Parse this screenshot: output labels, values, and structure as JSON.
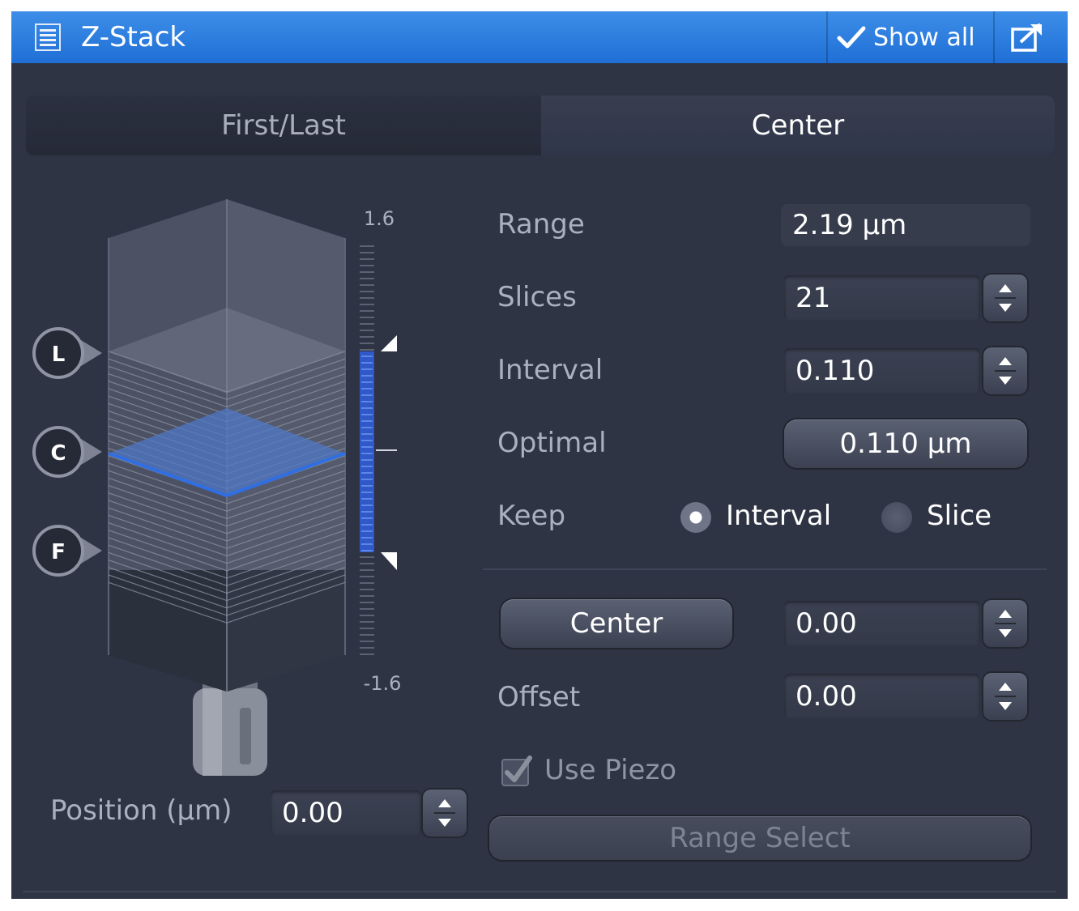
{
  "title_bar": {
    "title": "Z-Stack",
    "show_all": "Show all",
    "accent": "#2a7fe0"
  },
  "tabs": [
    {
      "label": "First/Last",
      "selected": false
    },
    {
      "label": "Center",
      "selected": true
    }
  ],
  "visual": {
    "scale_top": "1.6",
    "scale_bottom": "-1.6",
    "markers": [
      "L",
      "C",
      "F"
    ],
    "slice_highlight_color": "#2f6fe3"
  },
  "position": {
    "label": "Position (µm)",
    "value": "0.00"
  },
  "settings": {
    "range": {
      "label": "Range",
      "value": "2.19 µm"
    },
    "slices": {
      "label": "Slices",
      "value": "21"
    },
    "interval": {
      "label": "Interval",
      "value": "0.110"
    },
    "optimal": {
      "label": "Optimal",
      "button": "0.110 µm"
    },
    "keep": {
      "label": "Keep",
      "options": [
        {
          "label": "Interval",
          "selected": true
        },
        {
          "label": "Slice",
          "selected": false
        }
      ]
    },
    "center": {
      "button": "Center",
      "value": "0.00"
    },
    "offset": {
      "label": "Offset",
      "value": "0.00"
    },
    "use_piezo": {
      "label": "Use Piezo",
      "checked": true
    },
    "range_select": {
      "label": "Range Select"
    }
  }
}
